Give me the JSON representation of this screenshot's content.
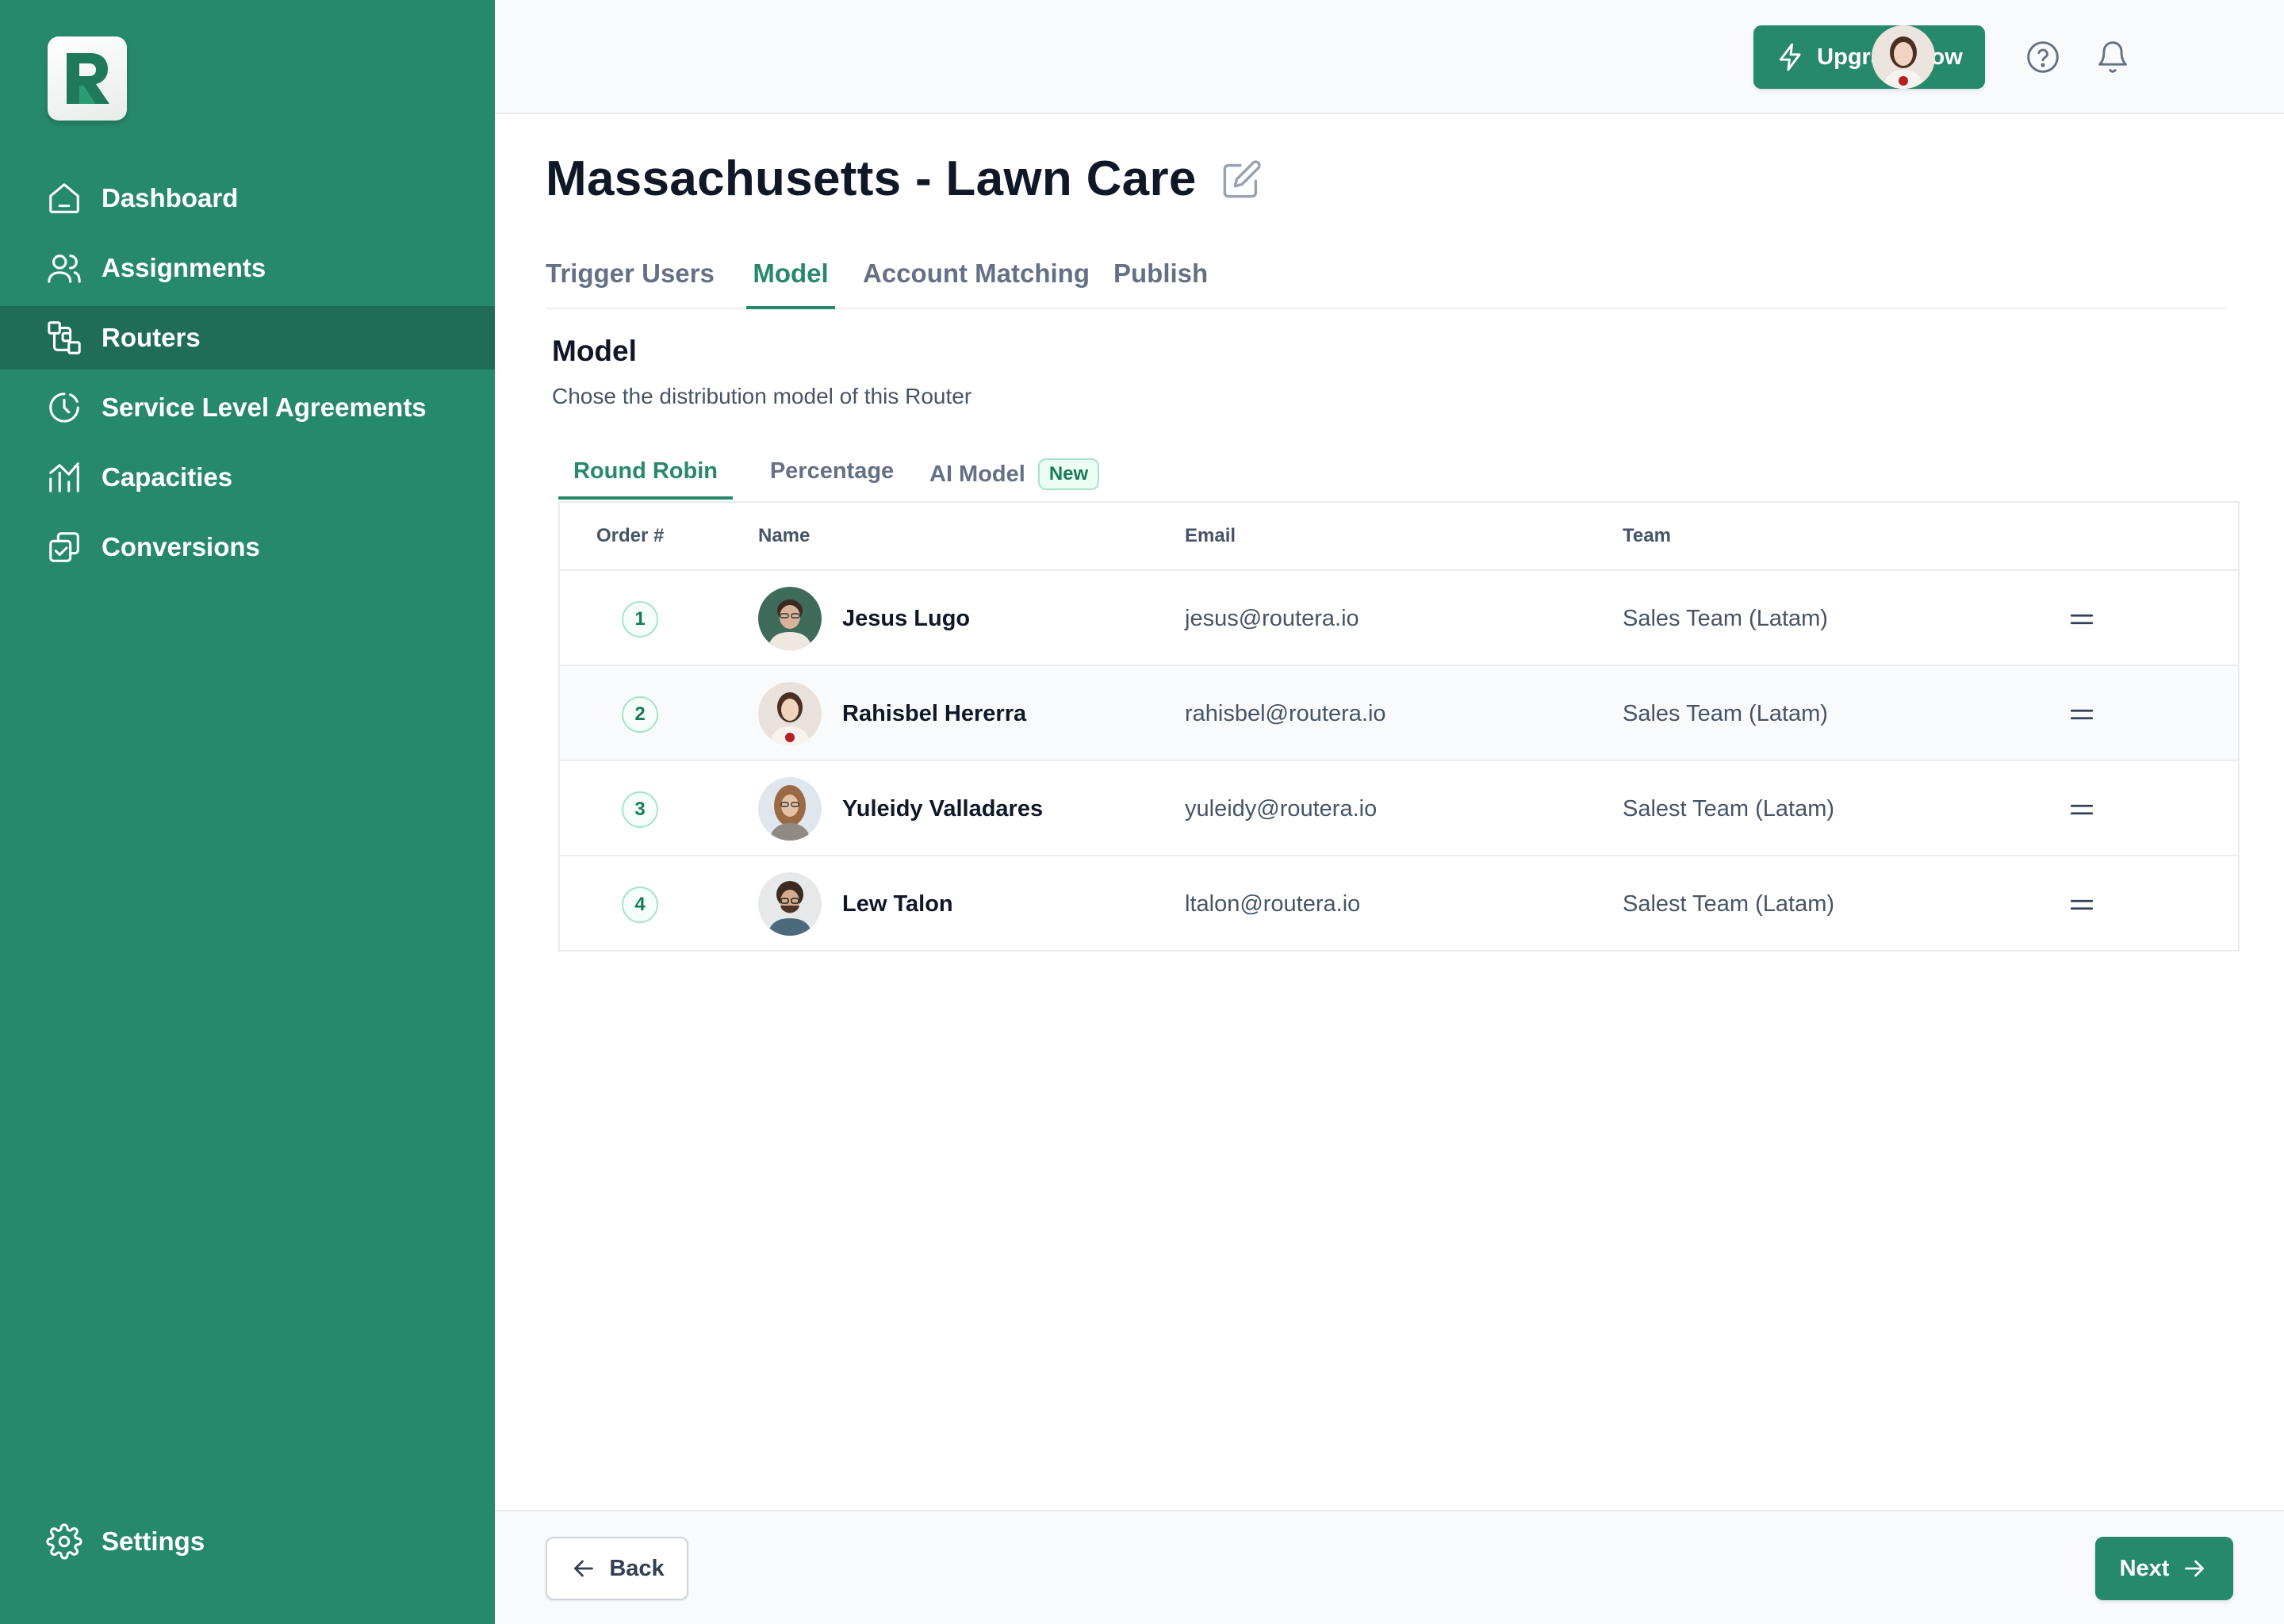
{
  "brand": {
    "logo_letter": "R",
    "accent": "#27896b",
    "sidebar_active": "#1f6d55"
  },
  "sidebar": {
    "items": [
      {
        "label": "Dashboard",
        "icon": "home-icon",
        "active": false
      },
      {
        "label": "Assignments",
        "icon": "users-icon",
        "active": false
      },
      {
        "label": "Routers",
        "icon": "router-icon",
        "active": true
      },
      {
        "label": "Service Level Agreements",
        "icon": "clock-icon",
        "active": false
      },
      {
        "label": "Capacities",
        "icon": "capacity-icon",
        "active": false
      },
      {
        "label": "Conversions",
        "icon": "conversion-icon",
        "active": false
      }
    ],
    "settings_label": "Settings"
  },
  "topbar": {
    "upgrade_label": "Upgrade now",
    "help_icon": "help-circle-icon",
    "notifications_icon": "bell-icon"
  },
  "page": {
    "title": "Massachusetts - Lawn Care",
    "tabs": [
      "Trigger",
      "Users",
      "Model",
      "Account Matching",
      "Publish"
    ],
    "active_tab": "Model"
  },
  "model_section": {
    "title": "Model",
    "description": "Chose the distribution model of this Router",
    "subtabs": [
      "Round Robin",
      "Percentage",
      "AI Model"
    ],
    "active_subtab": "Round Robin",
    "new_badge": "New"
  },
  "table": {
    "headers": {
      "order": "Order #",
      "name": "Name",
      "email": "Email",
      "team": "Team"
    },
    "rows": [
      {
        "order": "1",
        "name": "Jesus Lugo",
        "email": "jesus@routera.io",
        "team": "Sales Team (Latam)"
      },
      {
        "order": "2",
        "name": "Rahisbel Hererra",
        "email": "rahisbel@routera.io",
        "team": "Sales Team (Latam)"
      },
      {
        "order": "3",
        "name": "Yuleidy Valladares",
        "email": "yuleidy@routera.io",
        "team": "Salest Team (Latam)"
      },
      {
        "order": "4",
        "name": "Lew Talon",
        "email": "ltalon@routera.io",
        "team": "Salest Team (Latam)"
      }
    ]
  },
  "footer": {
    "back_label": "Back",
    "next_label": "Next"
  }
}
